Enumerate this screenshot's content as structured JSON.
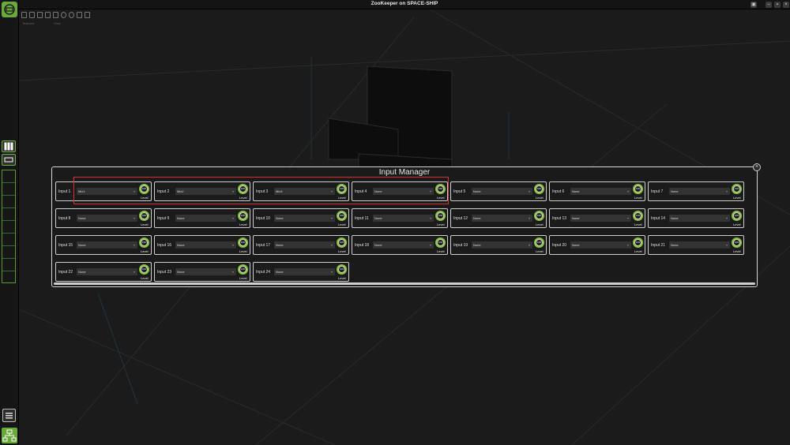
{
  "window": {
    "title": "ZooKeeper on SPACE-SHIP",
    "controls": [
      "▣",
      "–",
      "▪",
      "×"
    ]
  },
  "toolbar": {
    "labels": [
      "Textured",
      "View"
    ]
  },
  "panel": {
    "title": "Input Manager",
    "close_label": "×",
    "level_label": "Level",
    "knob_value": "100",
    "inputs": [
      {
        "label": "Input 1",
        "source": "Mix1"
      },
      {
        "label": "Input 2",
        "source": "Mix2"
      },
      {
        "label": "Input 3",
        "source": "Mix3"
      },
      {
        "label": "Input 4",
        "source": "None"
      },
      {
        "label": "Input 5",
        "source": "None"
      },
      {
        "label": "Input 6",
        "source": "None"
      },
      {
        "label": "Input 7",
        "source": "None"
      },
      {
        "label": "Input 8",
        "source": "None"
      },
      {
        "label": "Input 9",
        "source": "None"
      },
      {
        "label": "Input 10",
        "source": "None"
      },
      {
        "label": "Input 11",
        "source": "None"
      },
      {
        "label": "Input 12",
        "source": "None"
      },
      {
        "label": "Input 13",
        "source": "None"
      },
      {
        "label": "Input 14",
        "source": "None"
      },
      {
        "label": "Input 15",
        "source": "None"
      },
      {
        "label": "Input 16",
        "source": "None"
      },
      {
        "label": "Input 17",
        "source": "None"
      },
      {
        "label": "Input 18",
        "source": "None"
      },
      {
        "label": "Input 19",
        "source": "None"
      },
      {
        "label": "Input 20",
        "source": "None"
      },
      {
        "label": "Input 21",
        "source": "None"
      },
      {
        "label": "Input 22",
        "source": "None"
      },
      {
        "label": "Input 23",
        "source": "None"
      },
      {
        "label": "Input 24",
        "source": "None"
      }
    ]
  },
  "colors": {
    "accent": "#8bc53f",
    "highlight": "#d63232"
  }
}
